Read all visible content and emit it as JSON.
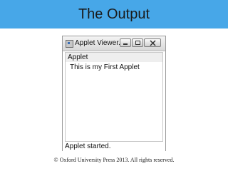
{
  "slide": {
    "title": "The Output",
    "banner_color": "#47a7e8",
    "copyright": "© Oxford University Press 2013. All rights reserved."
  },
  "window": {
    "title": "Applet Viewer...",
    "icon": "applet-viewer-icon",
    "buttons": [
      "minimize-icon",
      "maximize-icon",
      "close-icon"
    ],
    "menu_label": "Applet",
    "applet_text": "This is my First Applet",
    "status": "Applet started."
  }
}
